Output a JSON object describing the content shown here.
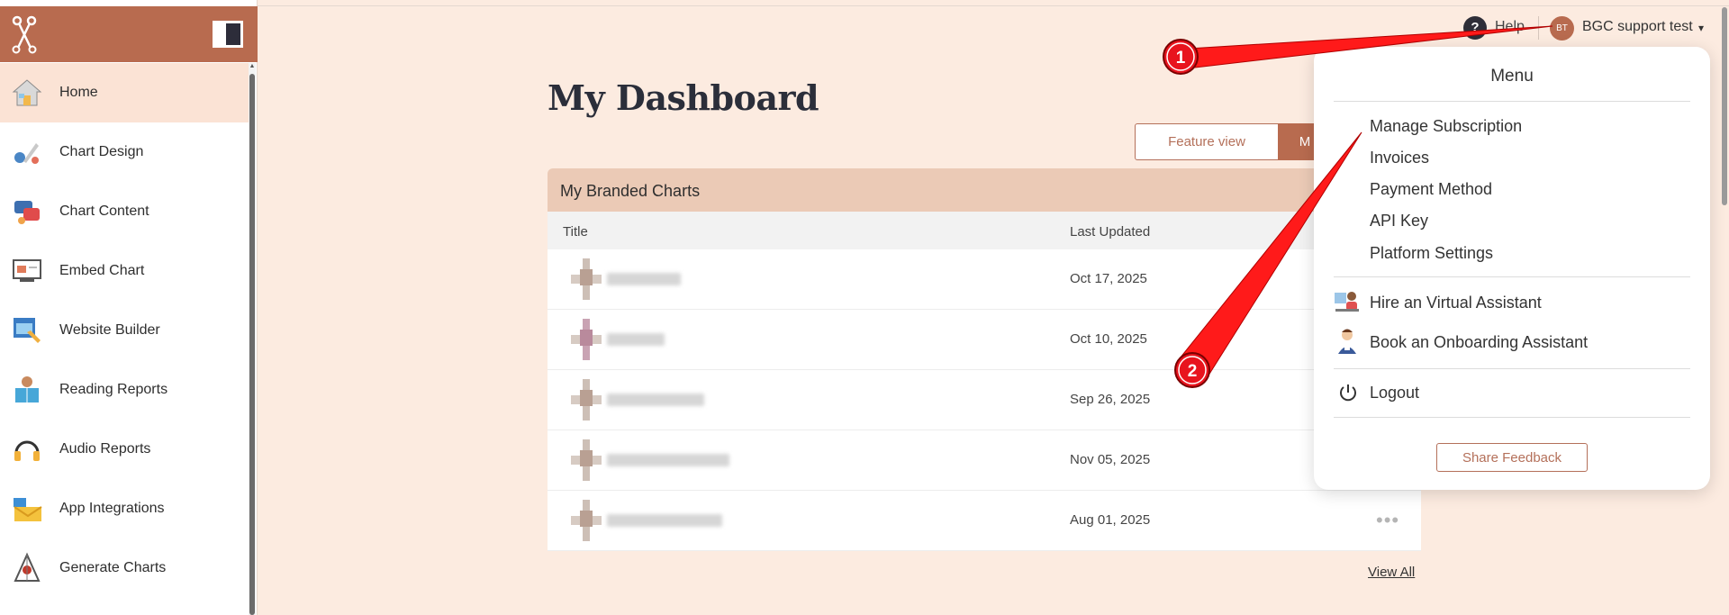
{
  "sidebar": {
    "items": [
      {
        "label": "Home",
        "icon": "home-icon"
      },
      {
        "label": "Chart Design",
        "icon": "chart-design-icon"
      },
      {
        "label": "Chart Content",
        "icon": "chart-content-icon"
      },
      {
        "label": "Embed Chart",
        "icon": "embed-chart-icon"
      },
      {
        "label": "Website Builder",
        "icon": "website-builder-icon"
      },
      {
        "label": "Reading Reports",
        "icon": "reading-reports-icon"
      },
      {
        "label": "Audio Reports",
        "icon": "audio-reports-icon"
      },
      {
        "label": "App Integrations",
        "icon": "app-integrations-icon"
      },
      {
        "label": "Generate Charts",
        "icon": "generate-charts-icon"
      }
    ],
    "active_item": "Home"
  },
  "header": {
    "help_label": "Help",
    "user_initials": "BT",
    "user_name": "BGC support test",
    "caret": "▾"
  },
  "main": {
    "title": "My Dashboard",
    "view_buttons": [
      "Feature view",
      "M"
    ],
    "card": {
      "title": "My Branded Charts",
      "columns": [
        "Title",
        "Last Updated"
      ],
      "rows": [
        {
          "date": "Oct 17, 2025"
        },
        {
          "date": "Oct 10, 2025"
        },
        {
          "date": "Sep 26, 2025"
        },
        {
          "date": "Nov 05, 2025"
        },
        {
          "date": "Aug 01, 2025"
        }
      ],
      "more_label": "•••",
      "view_all": "View All"
    }
  },
  "menu": {
    "title": "Menu",
    "account_items": [
      "Manage Subscription",
      "Invoices",
      "Payment Method",
      "API Key",
      "Platform Settings"
    ],
    "assistant_items": [
      "Hire an Virtual Assistant",
      "Book an Onboarding Assistant"
    ],
    "logout": "Logout",
    "share_feedback": "Share Feedback"
  },
  "annotations": {
    "marker_1": "1",
    "marker_2": "2",
    "color": "#ff1a1a"
  },
  "colors": {
    "brand": "#b86b4f",
    "background": "#fcebe0",
    "card_header": "#ebcab6"
  }
}
